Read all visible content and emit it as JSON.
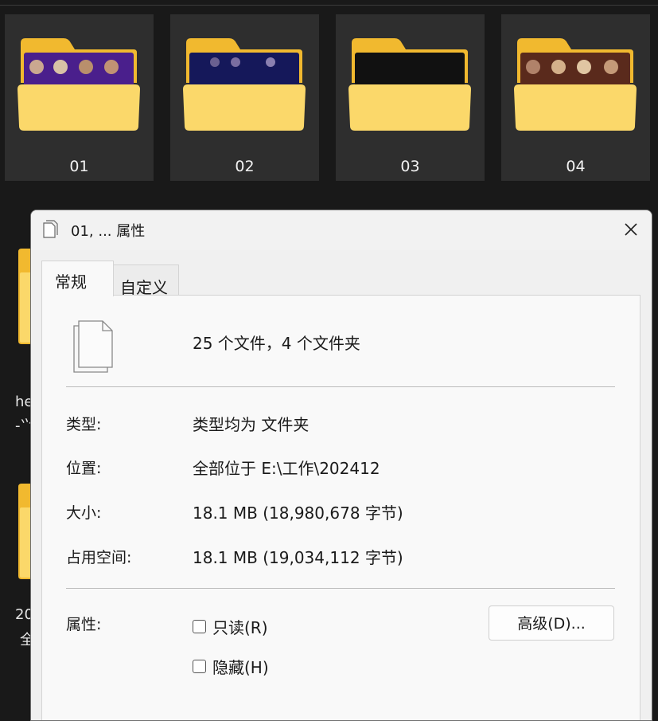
{
  "explorer": {
    "tiles": [
      {
        "label": "01",
        "preview": "purple-avatars"
      },
      {
        "label": "02",
        "preview": "dark-blue"
      },
      {
        "label": "03",
        "preview": "black"
      },
      {
        "label": "04",
        "preview": "brown-avatars"
      }
    ],
    "side_texts": [
      "he",
      "-⺍",
      "20",
      "全"
    ]
  },
  "dialog": {
    "title": "01, ... 属性",
    "tabs": {
      "general": "常规",
      "custom": "自定义"
    },
    "summary": "25 个文件，4 个文件夹",
    "rows": [
      {
        "label": "类型:",
        "value": "类型均为 文件夹"
      },
      {
        "label": "位置:",
        "value": "全部位于 E:\\工作\\202412"
      },
      {
        "label": "大小:",
        "value": "18.1 MB (18,980,678 字节)"
      },
      {
        "label": "占用空间:",
        "value": "18.1 MB (19,034,112 字节)"
      }
    ],
    "attributes_label": "属性:",
    "readonly_label": "只读(R)",
    "hidden_label": "隐藏(H)",
    "advanced_label": "高级(D)..."
  },
  "colors": {
    "folder_yellow": "#f5c94a",
    "folder_light": "#fde08c",
    "dialog_bg": "#f0f0f0",
    "explorer_bg": "#191919"
  }
}
